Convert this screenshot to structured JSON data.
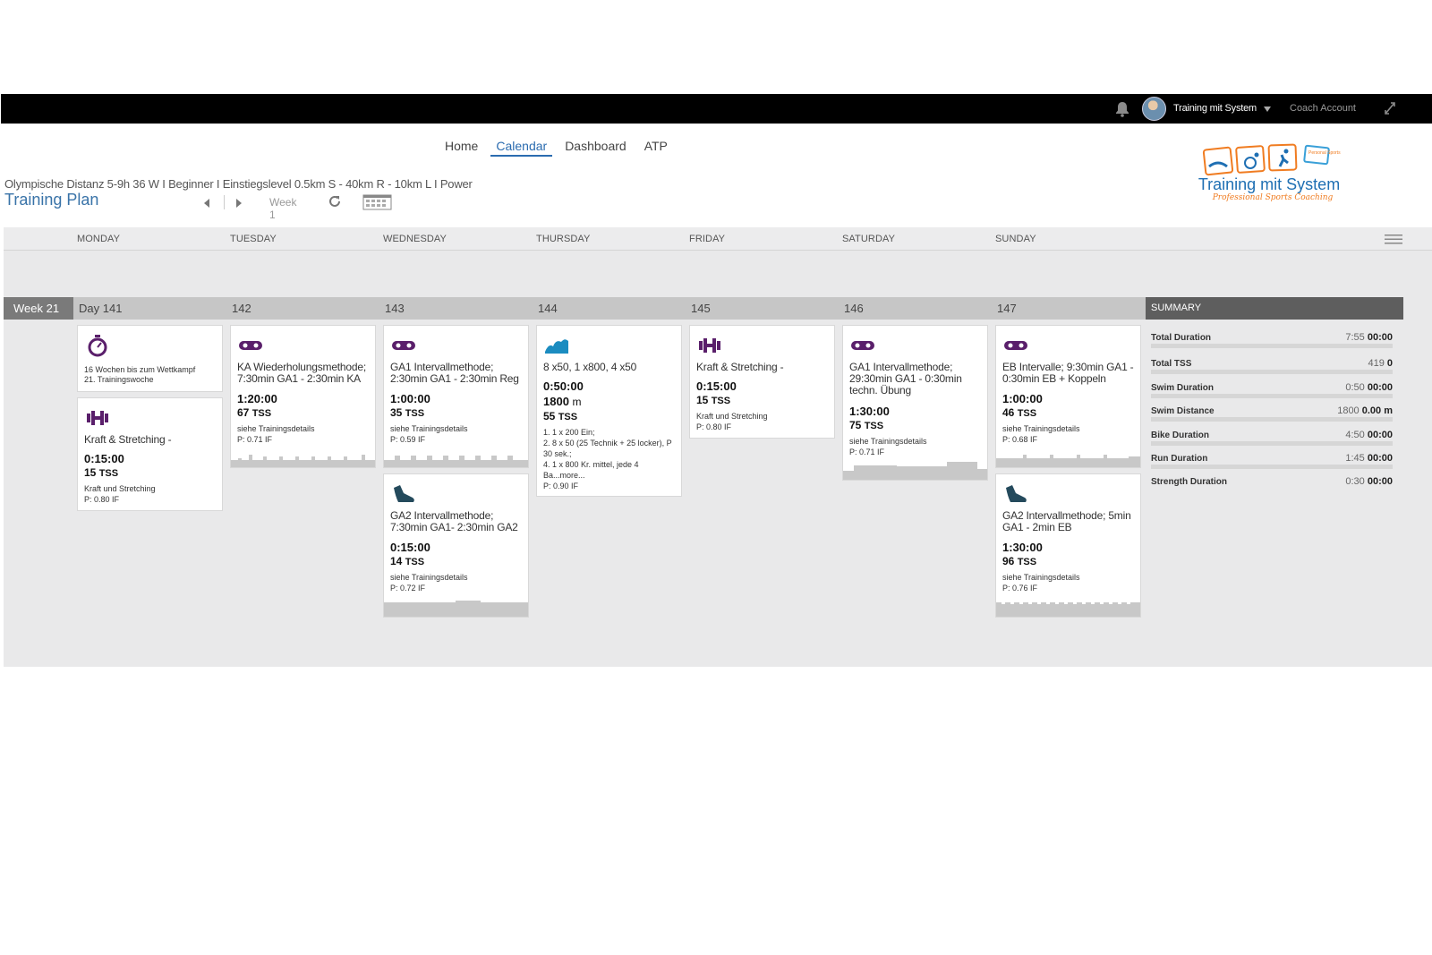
{
  "topbar": {
    "user_name": "Training mit System",
    "coach_account": "Coach Account"
  },
  "nav": {
    "items": [
      "Home",
      "Calendar",
      "Dashboard",
      "ATP"
    ],
    "active": "Calendar"
  },
  "plan": {
    "subtitle": "Olympische Distanz 5-9h 36 W I Beginner I Einstiegslevel 0.5km S - 40km R - 10km L I Power",
    "title": "Training Plan",
    "week_label": "Week 1"
  },
  "logo": {
    "text": "Training mit System",
    "tagline": "Professional Sports Coaching",
    "badge": "Personal Sports"
  },
  "days": [
    "MONDAY",
    "TUESDAY",
    "WEDNESDAY",
    "THURSDAY",
    "FRIDAY",
    "SATURDAY",
    "SUNDAY"
  ],
  "week": {
    "label": "Week 21",
    "day_numbers": [
      "Day 141",
      "142",
      "143",
      "144",
      "145",
      "146",
      "147"
    ]
  },
  "summary": {
    "title": "SUMMARY",
    "rows": [
      {
        "label": "Total Duration",
        "planned": "7:55",
        "done": "00:00"
      },
      {
        "label": "Total TSS",
        "planned": "419",
        "done": "0"
      },
      {
        "label": "Swim Duration",
        "planned": "0:50",
        "done": "00:00"
      },
      {
        "label": "Swim Distance",
        "planned": "1800",
        "done": "0.00 m"
      },
      {
        "label": "Bike Duration",
        "planned": "4:50",
        "done": "00:00"
      },
      {
        "label": "Run Duration",
        "planned": "1:45",
        "done": "00:00"
      },
      {
        "label": "Strength Duration",
        "planned": "0:30",
        "done": "00:00"
      }
    ]
  },
  "cards": {
    "mon_event": {
      "icon": "stopwatch-icon",
      "line1": "16 Wochen bis zum Wettkampf",
      "line2": "21. Trainingswoche"
    },
    "mon_strength": {
      "icon": "dumbbell-icon",
      "title": "Kraft & Stretching -",
      "duration": "0:15:00",
      "tss": "15",
      "desc": "Kraft und Stretching",
      "if": "P: 0.80 IF"
    },
    "tue_bike": {
      "icon": "bike-icon",
      "title": "KA Wiederholungsmethode; 7:30min GA1 - 2:30min KA",
      "duration": "1:20:00",
      "tss": "67",
      "desc": "siehe Trainingsdetails",
      "if": "P: 0.71 IF"
    },
    "wed_bike": {
      "icon": "bike-icon",
      "title": "GA1 Intervallmethode; 2:30min GA1 - 2:30min Reg",
      "duration": "1:00:00",
      "tss": "35",
      "desc": "siehe Trainingsdetails",
      "if": "P: 0.59 IF"
    },
    "wed_run": {
      "icon": "shoe-icon",
      "title": "GA2 Intervallmethode; 7:30min GA1- 2:30min GA2",
      "duration": "0:15:00",
      "tss": "14",
      "desc": "siehe Trainingsdetails",
      "if": "P: 0.72 IF"
    },
    "thu_swim": {
      "icon": "wave-icon",
      "title": "8 x50, 1 x800, 4 x50",
      "duration": "0:50:00",
      "distance": "1800",
      "distance_unit": "m",
      "tss": "55",
      "d1": "1. 1 x 200 Ein;",
      "d2": "2. 8 x 50 (25 Technik + 25 locker), P 30 sek.;",
      "d3": "4. 1 x 800 Kr. mittel, jede 4 Ba...more...",
      "if": "P: 0.90 IF"
    },
    "fri_strength": {
      "icon": "dumbbell-icon",
      "title": "Kraft & Stretching -",
      "duration": "0:15:00",
      "tss": "15",
      "desc": "Kraft und Stretching",
      "if": "P: 0.80 IF"
    },
    "sat_bike": {
      "icon": "bike-icon",
      "title": "GA1 Intervallmethode; 29:30min GA1 - 0:30min techn. Übung",
      "duration": "1:30:00",
      "tss": "75",
      "desc": "siehe Trainingsdetails",
      "if": "P: 0.71 IF"
    },
    "sun_bike": {
      "icon": "bike-icon",
      "title": "EB Intervalle; 9:30min GA1 - 0:30min EB + Koppeln",
      "duration": "1:00:00",
      "tss": "46",
      "desc": "siehe Trainingsdetails",
      "if": "P: 0.68 IF"
    },
    "sun_run": {
      "icon": "shoe-icon",
      "title": "GA2 Intervallmethode; 5min GA1 - 2min EB",
      "duration": "1:30:00",
      "tss": "96",
      "desc": "siehe Trainingsdetails",
      "if": "P: 0.76 IF"
    }
  },
  "tss_unit": "TSS",
  "colors": {
    "accent": "#2b6cb0",
    "workout_icon": "#5a1f6b",
    "swim_icon": "#1b8cc0",
    "run_icon": "#244a5c"
  }
}
